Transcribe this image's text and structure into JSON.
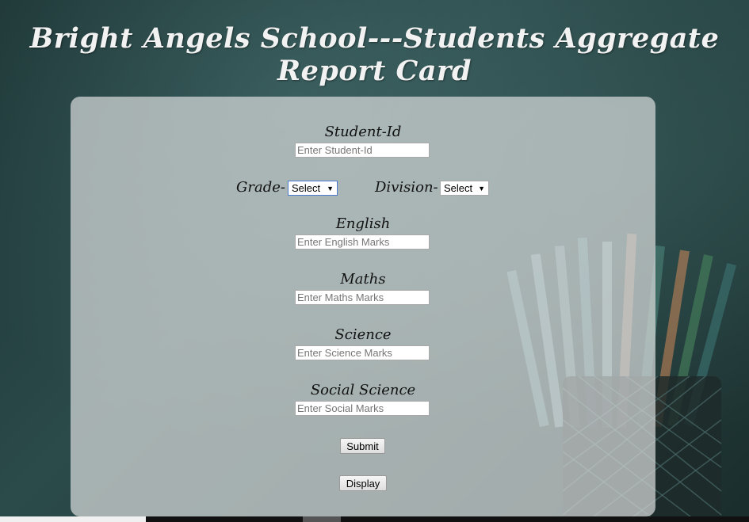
{
  "header": {
    "title": "Bright Angels School---Students Aggregate Report Card"
  },
  "form": {
    "student_id": {
      "label": "Student-Id",
      "placeholder": "Enter Student-Id"
    },
    "grade": {
      "label": "Grade-",
      "selected": "Select"
    },
    "division": {
      "label": "Division-",
      "selected": "Select"
    },
    "english": {
      "label": "English",
      "placeholder": "Enter English Marks"
    },
    "maths": {
      "label": "Maths",
      "placeholder": "Enter Maths Marks"
    },
    "science": {
      "label": "Science",
      "placeholder": "Enter Science Marks"
    },
    "social_science": {
      "label": "Social Science",
      "placeholder": "Enter Social Marks"
    },
    "submit_label": "Submit",
    "display_label": "Display"
  },
  "icons": {
    "dropdown": "caret-down-icon"
  }
}
